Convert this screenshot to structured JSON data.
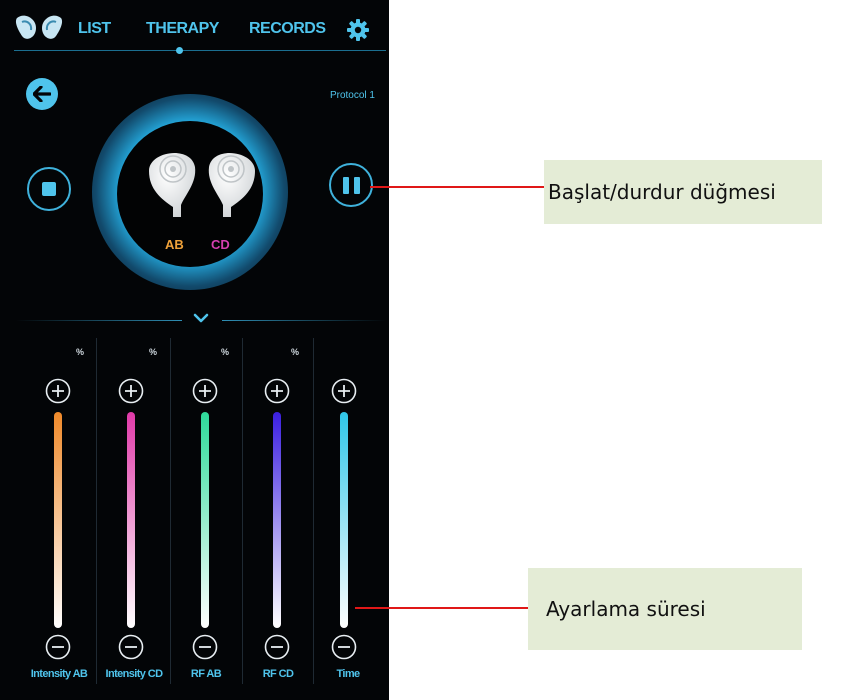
{
  "nav": {
    "tabs": [
      "LIST",
      "THERAPY",
      "RECORDS"
    ],
    "active_tab": "THERAPY"
  },
  "header": {
    "protocol": "Protocol 1"
  },
  "channels": {
    "ab": "AB",
    "cd": "CD"
  },
  "sliders": [
    {
      "label": "Intensity AB",
      "unit": "%",
      "color_top": "#f08a2a",
      "color_bottom": "#ffffff"
    },
    {
      "label": "Intensity CD",
      "unit": "%",
      "color_top": "#e03aa8",
      "color_bottom": "#ffffff"
    },
    {
      "label": "RF AB",
      "unit": "%",
      "color_top": "#2ed99a",
      "color_bottom": "#ffffff"
    },
    {
      "label": "RF CD",
      "unit": "%",
      "color_top": "#3b1fe0",
      "color_bottom": "#ffffff"
    },
    {
      "label": "Time",
      "unit": "",
      "color_top": "#2fc6e8",
      "color_bottom": "#ffffff"
    }
  ],
  "annotations": {
    "start_stop": "Başlat/durdur düğmesi",
    "duration": "Ayarlama süresi"
  },
  "colors": {
    "accent": "#4fc4ec",
    "background": "#030507",
    "annotation_line": "#e01818",
    "annotation_bg": "#e4ecd6"
  },
  "icons": [
    "app-logo-icon",
    "gear-icon",
    "back-arrow-icon",
    "stop-icon",
    "pause-icon",
    "chevron-down-icon",
    "plus-icon",
    "minus-icon"
  ]
}
